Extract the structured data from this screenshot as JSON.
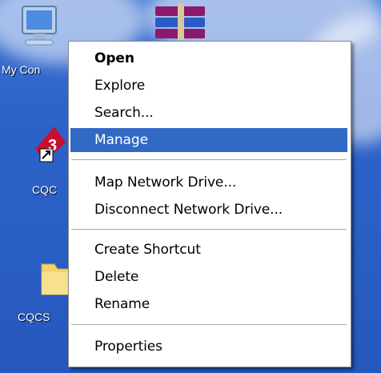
{
  "desktop": {
    "icons": [
      {
        "label": "My Con",
        "icon": "my-computer-icon"
      },
      {
        "label": "",
        "icon": "winrar-archive-icon"
      },
      {
        "label": "CQC",
        "icon": "cqc-shortcut-icon"
      },
      {
        "label": "CQCS",
        "icon": "folder-icon"
      }
    ]
  },
  "context_menu": {
    "items": [
      {
        "label": "Open",
        "bold": true
      },
      {
        "label": "Explore"
      },
      {
        "label": "Search..."
      },
      {
        "label": "Manage",
        "highlighted": true
      },
      {
        "label": "Map Network Drive..."
      },
      {
        "label": "Disconnect Network Drive..."
      },
      {
        "label": "Create Shortcut"
      },
      {
        "label": "Delete"
      },
      {
        "label": "Rename"
      },
      {
        "label": "Properties"
      }
    ],
    "highlight_color": "#316ac5"
  }
}
